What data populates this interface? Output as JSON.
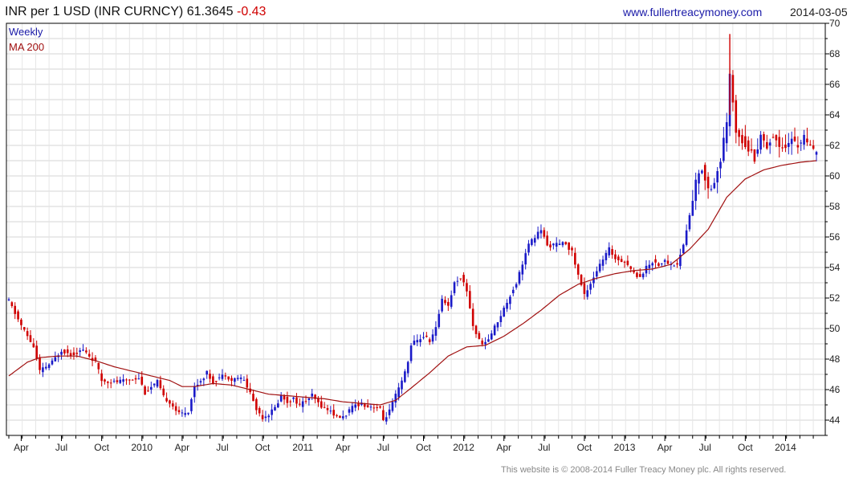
{
  "header": {
    "title_prefix": "INR per 1 USD (INR CURNCY) 61.3645",
    "change": "-0.43",
    "website": "www.fullertreacymoney.com",
    "date": "2014-03-05"
  },
  "footer": {
    "copyright": "This website is © 2008-2014 Fuller Treacy Money plc. All rights reserved."
  },
  "colors": {
    "up": "#1a1ac8",
    "down": "#d00000",
    "ma": "#a01010",
    "grid": "#d4d4d4",
    "axis": "#000000"
  },
  "chart_data": {
    "type": "candlestick",
    "frequency": "Weekly",
    "legend": [
      {
        "label": "Weekly",
        "color": "#1a1aa8"
      },
      {
        "label": "MA 200",
        "color": "#a01010"
      }
    ],
    "legend_position": "top-left",
    "y_axis_position": "right",
    "grid": true,
    "ylim": [
      43,
      70
    ],
    "yticks": [
      44,
      46,
      48,
      50,
      52,
      54,
      56,
      58,
      60,
      62,
      64,
      66,
      68,
      70
    ],
    "x_range_index": [
      0,
      261
    ],
    "xticks": [
      {
        "label": "Apr",
        "i": 4
      },
      {
        "label": "Jul",
        "i": 17
      },
      {
        "label": "Oct",
        "i": 30
      },
      {
        "label": "2010",
        "i": 43
      },
      {
        "label": "Apr",
        "i": 56
      },
      {
        "label": "Jul",
        "i": 69
      },
      {
        "label": "Oct",
        "i": 82
      },
      {
        "label": "2011",
        "i": 95
      },
      {
        "label": "Apr",
        "i": 108
      },
      {
        "label": "Jul",
        "i": 121
      },
      {
        "label": "Oct",
        "i": 134
      },
      {
        "label": "2012",
        "i": 147
      },
      {
        "label": "Apr",
        "i": 160
      },
      {
        "label": "Jul",
        "i": 173
      },
      {
        "label": "Oct",
        "i": 186
      },
      {
        "label": "2013",
        "i": 199
      },
      {
        "label": "Apr",
        "i": 212
      },
      {
        "label": "Jul",
        "i": 225
      },
      {
        "label": "Oct",
        "i": 238
      },
      {
        "label": "2014",
        "i": 251
      }
    ],
    "price_path": [
      [
        0,
        51.8
      ],
      [
        4,
        50.2
      ],
      [
        8,
        48.8
      ],
      [
        10,
        47.2
      ],
      [
        14,
        47.8
      ],
      [
        17,
        48.6
      ],
      [
        20,
        48.3
      ],
      [
        24,
        48.6
      ],
      [
        28,
        47.8
      ],
      [
        30,
        46.6
      ],
      [
        34,
        46.5
      ],
      [
        38,
        46.6
      ],
      [
        42,
        46.8
      ],
      [
        44,
        45.8
      ],
      [
        48,
        46.5
      ],
      [
        50,
        45.5
      ],
      [
        52,
        45.2
      ],
      [
        55,
        44.4
      ],
      [
        58,
        44.6
      ],
      [
        60,
        46.2
      ],
      [
        62,
        46.6
      ],
      [
        64,
        47.1
      ],
      [
        66,
        46.5
      ],
      [
        68,
        46.8
      ],
      [
        70,
        47.0
      ],
      [
        72,
        46.6
      ],
      [
        74,
        46.8
      ],
      [
        76,
        46.6
      ],
      [
        78,
        45.8
      ],
      [
        80,
        44.7
      ],
      [
        82,
        44.2
      ],
      [
        84,
        44.4
      ],
      [
        86,
        44.8
      ],
      [
        88,
        45.6
      ],
      [
        90,
        45.2
      ],
      [
        92,
        45.4
      ],
      [
        94,
        45.0
      ],
      [
        96,
        45.3
      ],
      [
        98,
        45.6
      ],
      [
        100,
        45.1
      ],
      [
        102,
        44.8
      ],
      [
        104,
        44.6
      ],
      [
        106,
        44.2
      ],
      [
        108,
        44.2
      ],
      [
        110,
        44.6
      ],
      [
        112,
        45.0
      ],
      [
        114,
        45.1
      ],
      [
        116,
        44.9
      ],
      [
        118,
        44.9
      ],
      [
        120,
        44.7
      ],
      [
        121,
        44.0
      ],
      [
        123,
        44.6
      ],
      [
        125,
        45.6
      ],
      [
        127,
        46.5
      ],
      [
        129,
        47.8
      ],
      [
        130,
        49.0
      ],
      [
        132,
        49.2
      ],
      [
        134,
        49.5
      ],
      [
        136,
        49.2
      ],
      [
        138,
        50.0
      ],
      [
        140,
        52.0
      ],
      [
        142,
        51.5
      ],
      [
        144,
        53.0
      ],
      [
        146,
        53.4
      ],
      [
        148,
        52.5
      ],
      [
        150,
        50.2
      ],
      [
        152,
        49.2
      ],
      [
        154,
        49.0
      ],
      [
        156,
        49.7
      ],
      [
        158,
        50.5
      ],
      [
        160,
        51.3
      ],
      [
        162,
        52.2
      ],
      [
        164,
        53.0
      ],
      [
        166,
        54.3
      ],
      [
        168,
        55.5
      ],
      [
        170,
        56.0
      ],
      [
        172,
        56.5
      ],
      [
        174,
        55.4
      ],
      [
        176,
        55.5
      ],
      [
        178,
        55.5
      ],
      [
        180,
        55.6
      ],
      [
        182,
        55.0
      ],
      [
        184,
        53.5
      ],
      [
        186,
        52.2
      ],
      [
        188,
        53.0
      ],
      [
        190,
        53.8
      ],
      [
        192,
        54.5
      ],
      [
        194,
        55.2
      ],
      [
        196,
        54.6
      ],
      [
        198,
        54.5
      ],
      [
        200,
        54.2
      ],
      [
        202,
        53.6
      ],
      [
        204,
        53.4
      ],
      [
        206,
        54.0
      ],
      [
        208,
        54.4
      ],
      [
        210,
        54.2
      ],
      [
        212,
        54.4
      ],
      [
        214,
        54.2
      ],
      [
        216,
        54.2
      ],
      [
        218,
        55.5
      ],
      [
        220,
        57.4
      ],
      [
        222,
        59.6
      ],
      [
        224,
        60.5
      ],
      [
        226,
        59.2
      ],
      [
        228,
        59.6
      ],
      [
        230,
        61.0
      ],
      [
        232,
        63.5
      ],
      [
        233,
        66.5
      ],
      [
        235,
        63.0
      ],
      [
        237,
        62.4
      ],
      [
        239,
        61.8
      ],
      [
        241,
        61.2
      ],
      [
        243,
        62.6
      ],
      [
        245,
        62.0
      ],
      [
        247,
        62.6
      ],
      [
        249,
        62.0
      ],
      [
        251,
        62.0
      ],
      [
        253,
        62.4
      ],
      [
        255,
        62.0
      ],
      [
        257,
        62.6
      ],
      [
        259,
        61.8
      ],
      [
        261,
        61.4
      ]
    ],
    "ma200": [
      [
        0,
        46.9
      ],
      [
        6,
        47.8
      ],
      [
        10,
        48.1
      ],
      [
        16,
        48.2
      ],
      [
        22,
        48.2
      ],
      [
        28,
        47.9
      ],
      [
        34,
        47.5
      ],
      [
        40,
        47.2
      ],
      [
        46,
        46.9
      ],
      [
        52,
        46.6
      ],
      [
        56,
        46.2
      ],
      [
        60,
        46.2
      ],
      [
        66,
        46.4
      ],
      [
        72,
        46.3
      ],
      [
        78,
        46.0
      ],
      [
        84,
        45.7
      ],
      [
        90,
        45.6
      ],
      [
        96,
        45.5
      ],
      [
        102,
        45.4
      ],
      [
        108,
        45.2
      ],
      [
        114,
        45.1
      ],
      [
        120,
        45.0
      ],
      [
        125,
        45.3
      ],
      [
        130,
        46.1
      ],
      [
        136,
        47.1
      ],
      [
        142,
        48.2
      ],
      [
        148,
        48.8
      ],
      [
        154,
        48.9
      ],
      [
        160,
        49.5
      ],
      [
        166,
        50.3
      ],
      [
        172,
        51.2
      ],
      [
        178,
        52.2
      ],
      [
        184,
        52.9
      ],
      [
        190,
        53.3
      ],
      [
        196,
        53.6
      ],
      [
        202,
        53.8
      ],
      [
        208,
        53.9
      ],
      [
        214,
        54.2
      ],
      [
        220,
        55.2
      ],
      [
        226,
        56.5
      ],
      [
        232,
        58.6
      ],
      [
        238,
        59.8
      ],
      [
        244,
        60.4
      ],
      [
        250,
        60.7
      ],
      [
        256,
        60.9
      ],
      [
        261,
        61.0
      ]
    ],
    "volatility": 0.28,
    "seed": 11
  }
}
